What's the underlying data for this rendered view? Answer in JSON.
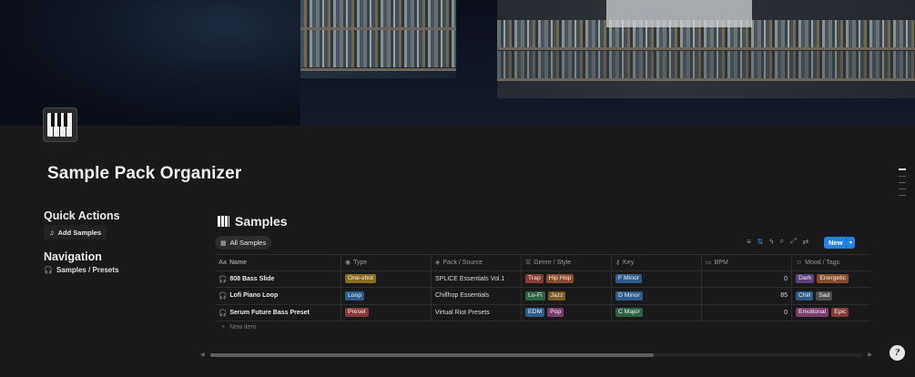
{
  "page": {
    "title": "Sample Pack Organizer",
    "icon": "piano-icon"
  },
  "sidebar": {
    "quick_actions": {
      "heading": "Quick Actions",
      "button_label": "Add Samples",
      "button_icon": "music-note-icon"
    },
    "navigation": {
      "heading": "Navigation",
      "link_label": "Samples / Presets",
      "link_icon": "headphones-icon"
    }
  },
  "database": {
    "title": "Samples",
    "icon": "piano-icon",
    "view_tab": "All Samples",
    "new_button": "New",
    "new_item_label": "New item",
    "columns": [
      {
        "label": "Name",
        "icon": "Aa"
      },
      {
        "label": "Type",
        "icon": "select-icon"
      },
      {
        "label": "Pack / Source",
        "icon": "pack-icon"
      },
      {
        "label": "Genre / Style",
        "icon": "multi-select-icon"
      },
      {
        "label": "Key",
        "icon": "key-icon"
      },
      {
        "label": "BPM",
        "icon": "number-icon"
      },
      {
        "label": "Mood / Tags",
        "icon": "tags-icon"
      }
    ],
    "rows": [
      {
        "name": "808 Bass Slide",
        "type": "One-shot",
        "pack": "SPLICE Essentials Vol.1",
        "genres": [
          "Trap",
          "Hip Hop"
        ],
        "key": "F Minor",
        "bpm": "0",
        "moods": [
          "Dark",
          "Energetic"
        ]
      },
      {
        "name": "Lofi Piano Loop",
        "type": "Loop",
        "pack": "Chillhop Essentials",
        "genres": [
          "Lo-Fi",
          "Jazz"
        ],
        "key": "D Minor",
        "bpm": "85",
        "moods": [
          "Chill",
          "Sad"
        ]
      },
      {
        "name": "Serum Future Bass Preset",
        "type": "Preset",
        "pack": "Virtual Riot Presets",
        "genres": [
          "EDM",
          "Pop"
        ],
        "key": "C Major",
        "bpm": "0",
        "moods": [
          "Emotional",
          "Epic"
        ]
      }
    ]
  },
  "colors": {
    "One-shot": "#8a6a1e",
    "Loop": "#2d5b8a",
    "Preset": "#8a3a36",
    "Trap": "#8a3a36",
    "Hip Hop": "#8a4b2c",
    "Lo-Fi": "#2e6142",
    "Jazz": "#7a5a22",
    "EDM": "#2d5b8a",
    "Pop": "#7a3d6e",
    "F Minor": "#2d5b8a",
    "D Minor": "#2d5b8a",
    "C Major": "#2e6142",
    "Dark": "#5b3f80",
    "Energetic": "#8a4b2c",
    "Chill": "#2d5b8a",
    "Sad": "#4f4f4f",
    "Emotional": "#7a3d6e",
    "Epic": "#8a3a36",
    "accent": "#2383e2"
  }
}
